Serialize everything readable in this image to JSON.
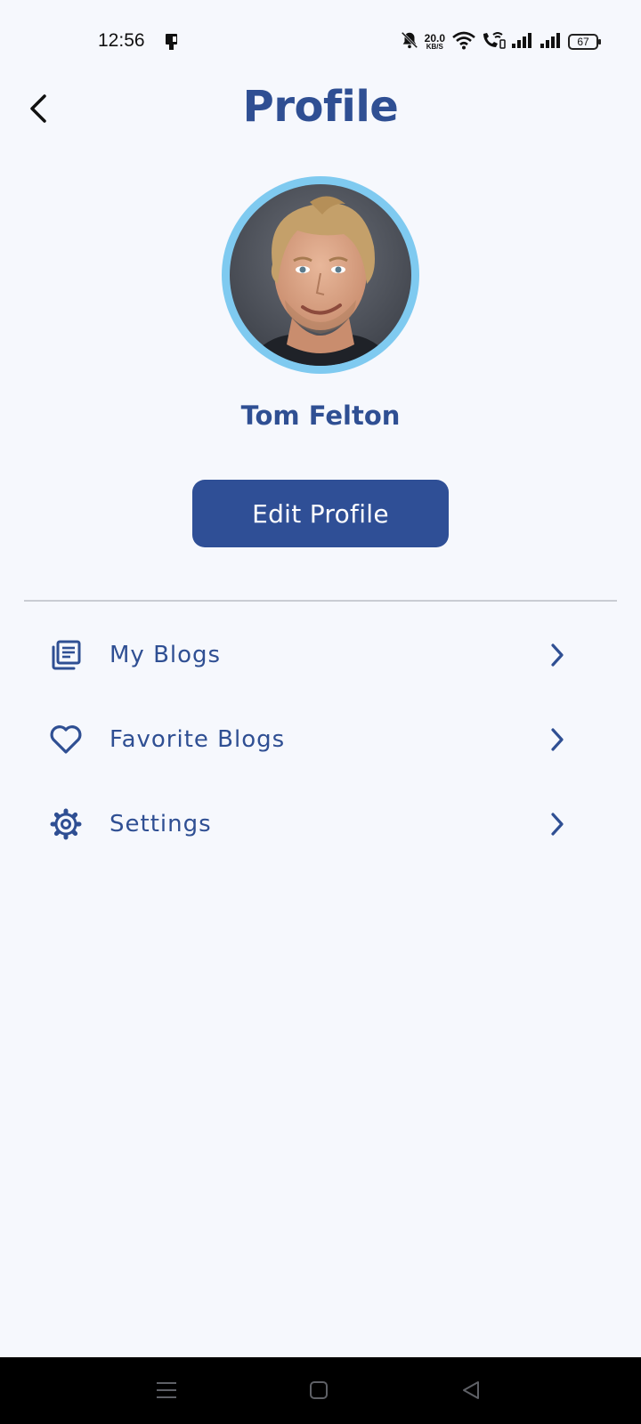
{
  "status_bar": {
    "time": "12:56",
    "net_speed_value": "20.0",
    "net_speed_unit": "KB/S",
    "battery": "67"
  },
  "header": {
    "title": "Profile",
    "back_icon": "chevron-left-icon"
  },
  "profile": {
    "name": "Tom Felton",
    "edit_button_label": "Edit Profile",
    "avatar_ring_color": "#7fcaf0"
  },
  "menu": {
    "items": [
      {
        "label": "My Blogs",
        "icon": "blog-list-icon"
      },
      {
        "label": "Favorite Blogs",
        "icon": "heart-icon"
      },
      {
        "label": "Settings",
        "icon": "gear-icon"
      }
    ]
  },
  "colors": {
    "primary": "#2f4f93",
    "button": "#2f4f96",
    "background": "#f6f8fd"
  }
}
